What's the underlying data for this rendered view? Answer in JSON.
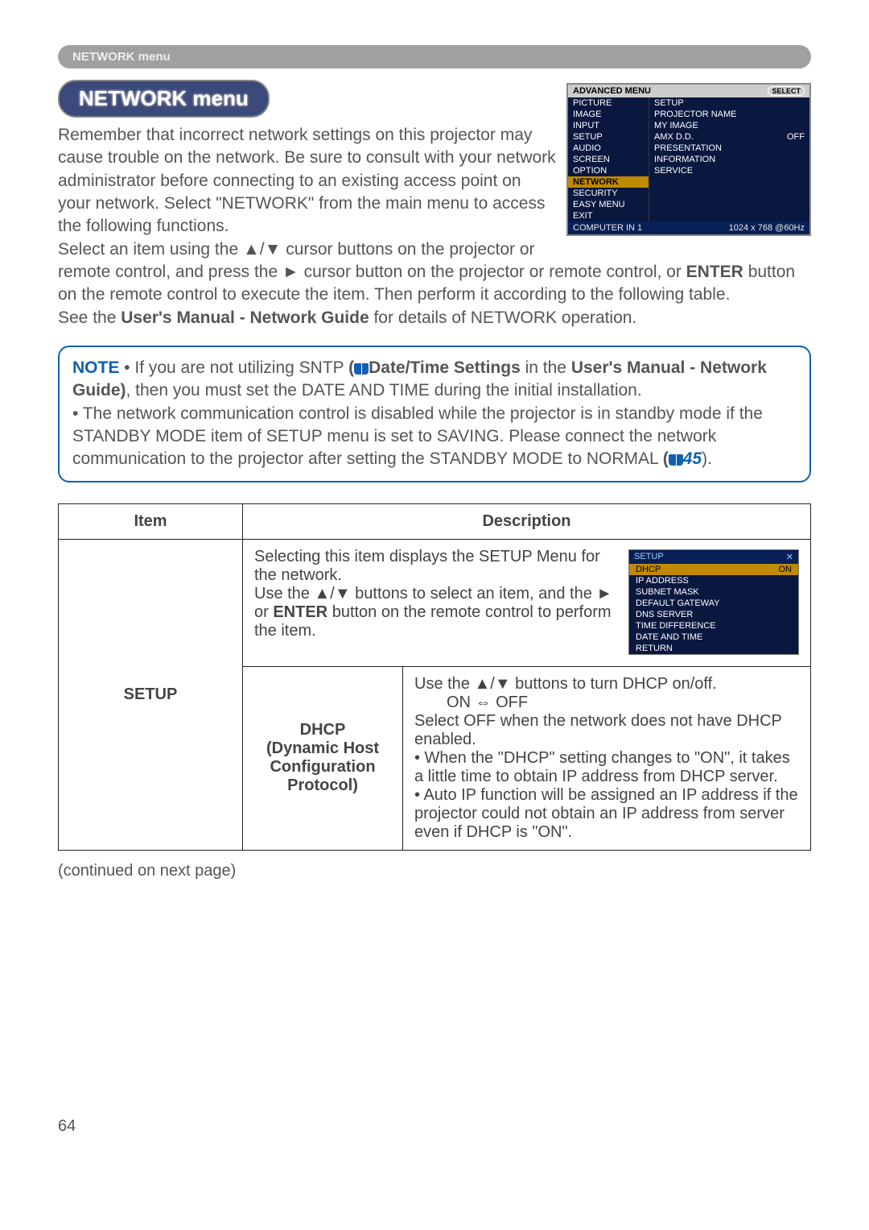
{
  "breadcrumb": "NETWORK menu",
  "section_title": "NETWORK menu",
  "intro_1": "Remember that incorrect network settings on this projector may cause trouble on the network. Be sure to consult with your network administrator before connecting to an existing access point on your network.",
  "intro_2": "Select \"NETWORK\" from the main menu to access the following functions.",
  "intro_3a": "Select an item using the ▲/▼ cursor buttons on the projector or remote control, and press the ► cursor button on the projector or remote control, or ",
  "intro_3b_bold": "ENTER",
  "intro_3c": " button on the remote control to execute the item. Then perform it according to the following table.",
  "intro_4a": "See the ",
  "intro_4b_bold": "User's Manual - Network Guide",
  "intro_4c": " for details of NETWORK operation.",
  "note_label": "NOTE",
  "note_1a": " • If you are not utilizing SNTP ",
  "note_1b_bold": "Date/Time Settings",
  "note_1c": " in the ",
  "note_1d_bold": "User's Manual - Network Guide)",
  "note_1e": ", then you must set the DATE AND TIME during the initial installation.",
  "note_2a": "• The network communication control is disabled while the projector is in standby mode if the STANDBY MODE item of SETUP menu is set to SAVING. Please connect the network communication to the projector after setting the STANDBY MODE to NORMAL ",
  "note_2b_ref": "45",
  "note_2c": ").",
  "table": {
    "head_item": "Item",
    "head_desc": "Description",
    "row_label": "SETUP",
    "desc_top_a": "Selecting this item displays the SETUP Menu for the network.",
    "desc_top_b": "Use the ▲/▼ buttons to select an item, and the ► or ",
    "desc_top_b_bold": "ENTER",
    "desc_top_c": " button on the remote control to perform the item.",
    "sub_label_1": "DHCP",
    "sub_label_2": "(Dynamic Host Configuration Protocol)",
    "sub_desc_1": "Use the ▲/▼ buttons to turn DHCP on/off.",
    "sub_desc_2": "ON ⇔ OFF",
    "sub_desc_3": "Select OFF when the network does not have DHCP enabled.",
    "sub_desc_4": "• When the \"DHCP\" setting changes to \"ON\", it takes a little time to obtain IP address from DHCP server.",
    "sub_desc_5": "• Auto IP function will be assigned an IP address if the projector could not obtain an IP address from server even if DHCP is \"ON\"."
  },
  "continued": "(continued on next page)",
  "page_number": "64",
  "advmenu": {
    "title": "ADVANCED MENU",
    "select": "SELECT",
    "left": [
      "PICTURE",
      "IMAGE",
      "INPUT",
      "SETUP",
      "AUDIO",
      "SCREEN",
      "OPTION",
      "NETWORK",
      "SECURITY",
      "EASY MENU",
      "EXIT"
    ],
    "right": [
      {
        "l": "SETUP",
        "r": ""
      },
      {
        "l": "PROJECTOR NAME",
        "r": ""
      },
      {
        "l": "MY IMAGE",
        "r": ""
      },
      {
        "l": "AMX D.D.",
        "r": "OFF"
      },
      {
        "l": "PRESENTATION",
        "r": ""
      },
      {
        "l": "INFORMATION",
        "r": ""
      },
      {
        "l": "SERVICE",
        "r": ""
      }
    ],
    "foot_l": "COMPUTER IN 1",
    "foot_r": "1024 x 768 @60Hz"
  },
  "setupmenu": {
    "title": "SETUP",
    "rows": [
      {
        "l": "DHCP",
        "r": "ON",
        "hl": true
      },
      {
        "l": "IP ADDRESS",
        "r": ""
      },
      {
        "l": "SUBNET MASK",
        "r": ""
      },
      {
        "l": "DEFAULT GATEWAY",
        "r": ""
      },
      {
        "l": "DNS SERVER",
        "r": ""
      },
      {
        "l": "TIME DIFFERENCE",
        "r": ""
      },
      {
        "l": "DATE AND TIME",
        "r": ""
      },
      {
        "l": "RETURN",
        "r": ""
      }
    ]
  }
}
